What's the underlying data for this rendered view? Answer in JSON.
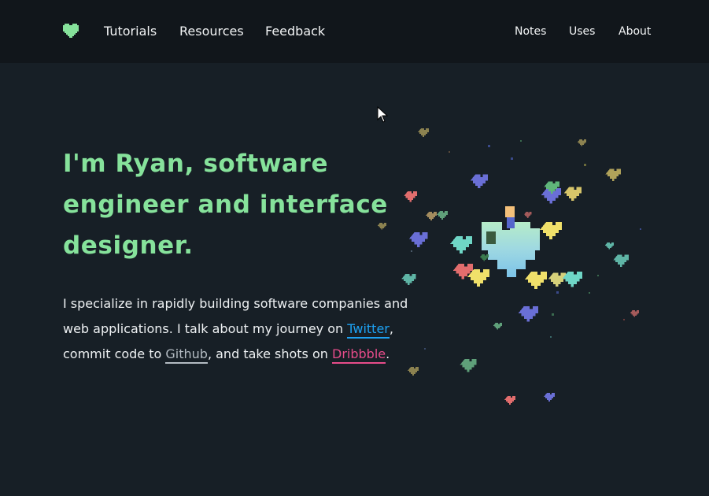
{
  "nav": {
    "logo": "heart-logo",
    "left": [
      "Tutorials",
      "Resources",
      "Feedback"
    ],
    "right": [
      "Notes",
      "Uses",
      "About"
    ]
  },
  "hero": {
    "title": "I'm Ryan, software engineer and interface designer.",
    "intro_a": "I specialize in rapidly building software companies and web applications. I talk about my journey on ",
    "twitter": "Twitter",
    "intro_b": ", commit code to ",
    "github": "Github",
    "intro_c": ", and take shots on ",
    "dribbble": "Dribbble",
    "intro_d": "."
  },
  "colors": {
    "background": "#171f26",
    "topbar": "#11161b",
    "accent_green": "#86e29b",
    "twitter": "#1da1f2",
    "github": "#b3bbc2",
    "dribbble": "#e74c8a"
  }
}
